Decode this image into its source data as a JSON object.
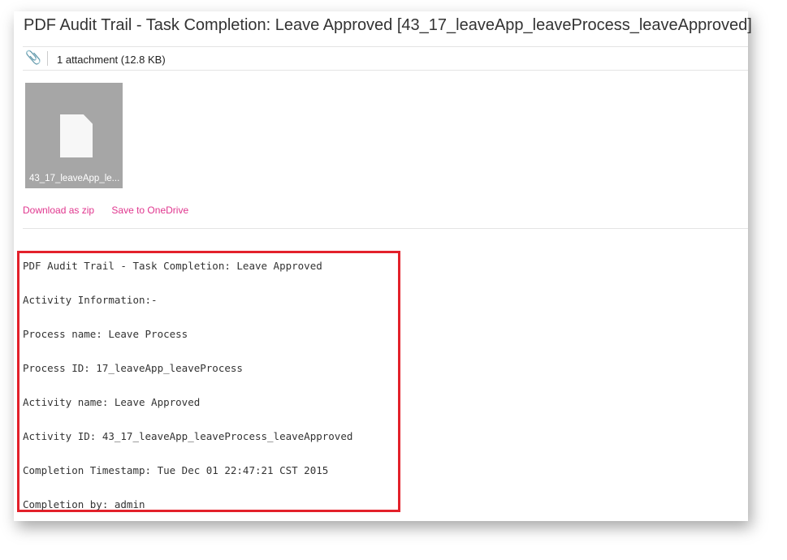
{
  "title": "PDF Audit Trail - Task Completion: Leave Approved [43_17_leaveApp_leaveProcess_leaveApproved]",
  "attachments": {
    "count_label": "1 attachment (12.8 KB)",
    "file_name": "43_17_leaveApp_le...",
    "download_zip": "Download as zip",
    "save_onedrive": "Save to OneDrive"
  },
  "body_lines": [
    "PDF Audit Trail - Task Completion: Leave Approved",
    "Activity Information:-",
    "Process name: Leave Process",
    "Process ID: 17_leaveApp_leaveProcess",
    "Activity name: Leave Approved",
    "Activity ID: 43_17_leaveApp_leaveProcess_leaveApproved",
    "Completion Timestamp: Tue Dec 01 22:47:21 CST 2015",
    "Completion by: admin"
  ],
  "highlight_color": "#e3212b",
  "link_color": "#e0368e"
}
